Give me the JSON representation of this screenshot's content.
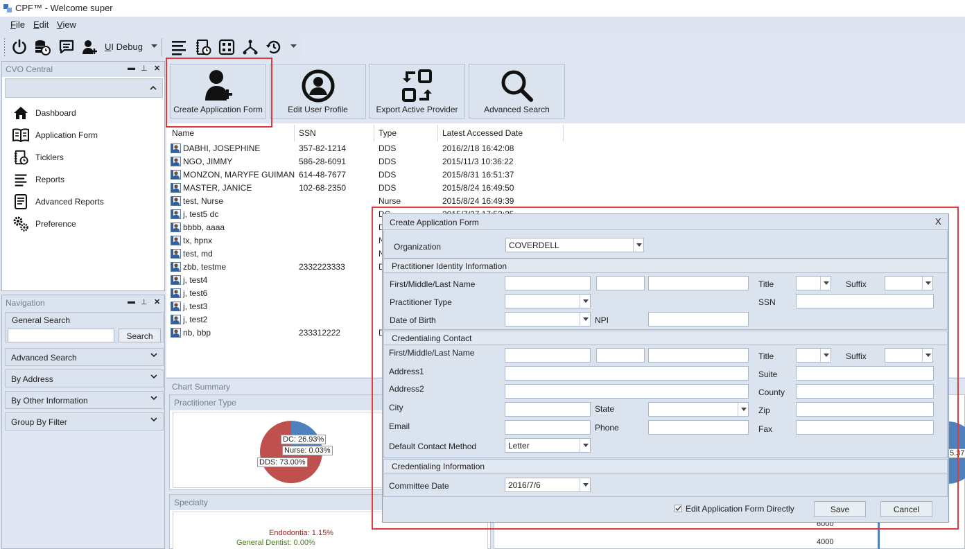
{
  "window": {
    "title": "CPF™  -  Welcome super"
  },
  "menu": [
    {
      "key": "F",
      "rest": "ile"
    },
    {
      "key": "E",
      "rest": "dit"
    },
    {
      "key": "V",
      "rest": "iew"
    }
  ],
  "toolbar": {
    "ui_debug_key": "U",
    "ui_debug_rest": "I Debug"
  },
  "cvo_panel": {
    "title": "CVO Central",
    "items": [
      {
        "label": "Dashboard",
        "icon": "home-icon"
      },
      {
        "label": "Application Form",
        "icon": "book-icon"
      },
      {
        "label": "Ticklers",
        "icon": "notebook-clock-icon"
      },
      {
        "label": "Reports",
        "icon": "lines-icon"
      },
      {
        "label": "Advanced Reports",
        "icon": "report-icon"
      },
      {
        "label": "Preference",
        "icon": "gears-icon"
      }
    ]
  },
  "nav_panel": {
    "title": "Navigation",
    "general_search": "General Search",
    "search_value": "",
    "search_button": "Search",
    "sections": [
      "Advanced Search",
      "By Address",
      "By Other Information",
      "Group By Filter"
    ]
  },
  "big_buttons": [
    {
      "label": "Create Application Form",
      "icon": "add-user-icon"
    },
    {
      "label": "Edit User Profile",
      "icon": "user-circle-icon"
    },
    {
      "label": "Export Active Provider",
      "icon": "export-icon"
    },
    {
      "label": "Advanced Search",
      "icon": "magnifier-icon"
    }
  ],
  "grid": {
    "columns": [
      "Name",
      "SSN",
      "Type",
      "Latest Accessed Date"
    ],
    "rows": [
      {
        "name": "DABHI, JOSEPHINE",
        "ssn": "357-82-1214",
        "type": "DDS",
        "date": "2016/2/18 16:42:08"
      },
      {
        "name": "NGO, JIMMY",
        "ssn": "586-28-6091",
        "type": "DDS",
        "date": "2015/11/3 10:36:22"
      },
      {
        "name": "MONZON, MARYFE GUIMAN",
        "ssn": "614-48-7677",
        "type": "DDS",
        "date": "2015/8/31 16:51:37"
      },
      {
        "name": "MASTER, JANICE",
        "ssn": "102-68-2350",
        "type": "DDS",
        "date": "2015/8/24 16:49:50"
      },
      {
        "name": "test, Nurse",
        "ssn": "",
        "type": "Nurse",
        "date": "2015/8/24 16:49:39"
      },
      {
        "name": "j, test5 dc",
        "ssn": "",
        "type": "DC",
        "date": "2015/7/27 17:53:25"
      },
      {
        "name": "bbbb, aaaa",
        "ssn": "",
        "type": "D",
        "date": ""
      },
      {
        "name": "tx, hpnx",
        "ssn": "",
        "type": "N",
        "date": ""
      },
      {
        "name": "test, md",
        "ssn": "",
        "type": "N",
        "date": ""
      },
      {
        "name": "zbb, testme",
        "ssn": "2332223333",
        "type": "D",
        "date": ""
      },
      {
        "name": "j, test4",
        "ssn": "",
        "type": "",
        "date": ""
      },
      {
        "name": "j, test6",
        "ssn": "",
        "type": "",
        "date": ""
      },
      {
        "name": "j, test3",
        "ssn": "",
        "type": "",
        "date": ""
      },
      {
        "name": "j, test2",
        "ssn": "",
        "type": "",
        "date": ""
      },
      {
        "name": "nb, bbp",
        "ssn": "233312222",
        "type": "D",
        "date": ""
      }
    ]
  },
  "charts": {
    "summary_title": "Chart Summary",
    "practitioner_title": "Practitioner Type",
    "specialty_title": "Specialty",
    "right_label": "5.37",
    "axis_labels": [
      "6000",
      "4000"
    ],
    "specialty_labels": [
      "Endodontia: 1.15%",
      "General Dentist: 0.00%"
    ]
  },
  "chart_data": {
    "type": "pie",
    "title": "Practitioner Type",
    "slices": [
      {
        "label": "DC: 26.93%",
        "value": 26.93,
        "color": "#4f81bd"
      },
      {
        "label": "Nurse: 0.03%",
        "value": 0.03,
        "color": "#9bbb59"
      },
      {
        "label": "DDS: 73.00%",
        "value": 73.0,
        "color": "#c0504d"
      }
    ]
  },
  "dialog": {
    "title": "Create Application Form",
    "close": "X",
    "organization_label": "Organization",
    "organization_value": "COVERDELL",
    "identity": {
      "header": "Practitioner Identity Information",
      "name_label": "First/Middle/Last Name",
      "type_label": "Practitioner Type",
      "dob_label": "Date of Birth",
      "npi_label": "NPI",
      "title_label": "Title",
      "suffix_label": "Suffix",
      "ssn_label": "SSN"
    },
    "contact": {
      "header": "Credentialing Contact",
      "name_label": "First/Middle/Last Name",
      "address1_label": "Address1",
      "address2_label": "Address2",
      "city_label": "City",
      "state_label": "State",
      "email_label": "Email",
      "phone_label": "Phone",
      "method_label": "Default Contact Method",
      "method_value": "Letter",
      "title_label": "Title",
      "suffix_label": "Suffix",
      "suite_label": "Suite",
      "county_label": "County",
      "zip_label": "Zip",
      "fax_label": "Fax"
    },
    "cred_info": {
      "header": "Credentialing Information",
      "committee_label": "Committee Date",
      "committee_value": "2016/7/6"
    },
    "edit_directly_label": "Edit Application Form Directly",
    "edit_directly_checked": true,
    "save": "Save",
    "cancel": "Cancel"
  }
}
